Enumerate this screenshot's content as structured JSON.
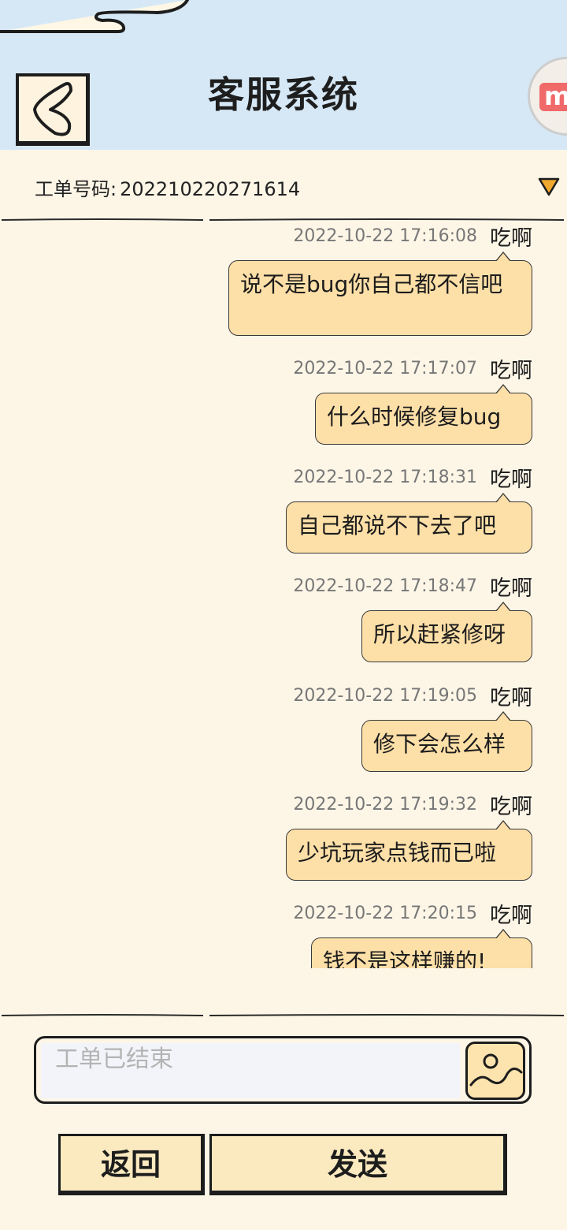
{
  "header": {
    "title": "客服系统",
    "back_icon": "back-chevron-icon",
    "logo_text": "m",
    "colors": {
      "header_bg": "#d6e8f6",
      "page_bg": "#fdf6e7"
    }
  },
  "ticket": {
    "label": "工单号码:",
    "number": "202210220271614",
    "dropdown_icon": "triangle-down-icon",
    "dropdown_color": "#f0a92e"
  },
  "messages": [
    {
      "time": "2022-10-22 17:16:08",
      "sender": "吃啊",
      "text": "说不是bug你自己都不信吧"
    },
    {
      "time": "2022-10-22 17:17:07",
      "sender": "吃啊",
      "text": "什么时候修复bug"
    },
    {
      "time": "2022-10-22 17:18:31",
      "sender": "吃啊",
      "text": "自己都说不下去了吧"
    },
    {
      "time": "2022-10-22 17:18:47",
      "sender": "吃啊",
      "text": "所以赶紧修呀"
    },
    {
      "time": "2022-10-22 17:19:05",
      "sender": "吃啊",
      "text": "修下会怎么样"
    },
    {
      "time": "2022-10-22 17:19:32",
      "sender": "吃啊",
      "text": "少坑玩家点钱而已啦"
    },
    {
      "time": "2022-10-22 17:20:15",
      "sender": "吃啊",
      "text": "钱不是这样赚的!"
    }
  ],
  "input": {
    "placeholder": "工单已结束",
    "value": "",
    "image_icon": "image-picture-icon"
  },
  "buttons": {
    "back_label": "返回",
    "send_label": "发送"
  },
  "colors": {
    "bubble": "#fddfa8",
    "button": "#fbe9bf"
  }
}
